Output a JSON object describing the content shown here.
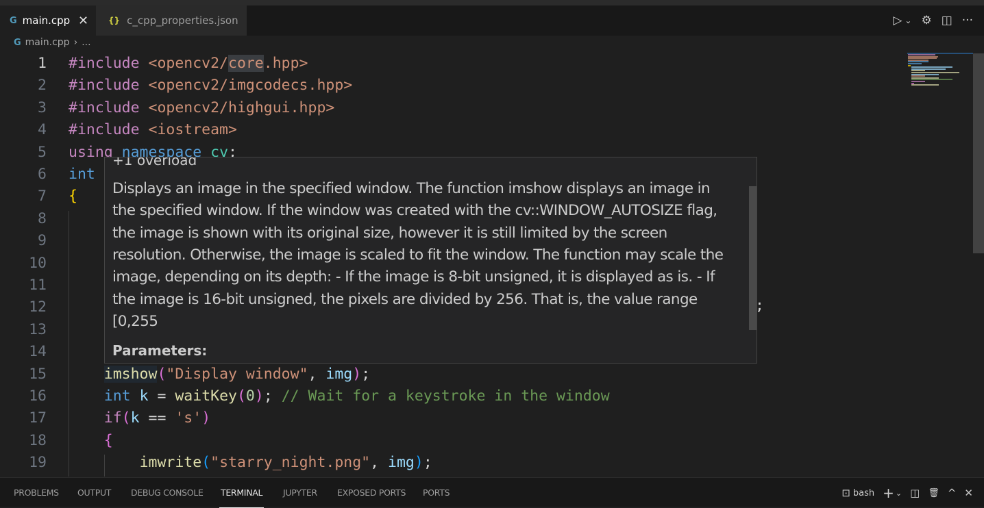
{
  "tabs": [
    {
      "label": "main.cpp",
      "icon": "cpp-icon",
      "active": true
    },
    {
      "label": "c_cpp_properties.json",
      "icon": "json-braces-icon",
      "active": false
    }
  ],
  "tab_icons": {
    "cpp": "G",
    "json": "{}",
    "close": "✕"
  },
  "toolbar": {
    "run": "▷",
    "run_dropdown": "⌄",
    "settings": "⚙",
    "split": "◫",
    "more": "···"
  },
  "breadcrumb": {
    "file": "main.cpp",
    "sep": "›",
    "rest": "..."
  },
  "editor": {
    "lines": [
      {
        "n": "1",
        "t": [
          [
            "#include ",
            "kw"
          ],
          [
            "<opencv2/",
            "str"
          ],
          [
            "core",
            "str hl"
          ],
          [
            ".hpp>",
            "str"
          ]
        ]
      },
      {
        "n": "2",
        "t": [
          [
            "#include ",
            "kw"
          ],
          [
            "<opencv2/imgcodecs.hpp>",
            "str"
          ]
        ]
      },
      {
        "n": "3",
        "t": [
          [
            "#include ",
            "kw"
          ],
          [
            "<opencv2/highgui.hpp>",
            "str"
          ]
        ]
      },
      {
        "n": "4",
        "t": [
          [
            "#include ",
            "kw"
          ],
          [
            "<iostream>",
            "str"
          ]
        ]
      },
      {
        "n": "5",
        "t": [
          [
            "using ",
            "kw"
          ],
          [
            "namespace ",
            "ty"
          ],
          [
            "cv",
            "ns"
          ],
          [
            ";",
            "pl"
          ]
        ]
      },
      {
        "n": "6",
        "t": [
          [
            "int",
            "ty"
          ]
        ]
      },
      {
        "n": "7",
        "t": [
          [
            "{",
            "b1"
          ]
        ]
      },
      {
        "n": "8",
        "t": []
      },
      {
        "n": "9",
        "t": []
      },
      {
        "n": "10",
        "t": []
      },
      {
        "n": "11",
        "t": []
      },
      {
        "n": "12",
        "t": []
      },
      {
        "n": "13",
        "t": []
      },
      {
        "n": "14",
        "t": []
      },
      {
        "n": "15",
        "t": [
          [
            "    ",
            "pl"
          ],
          [
            "imshow",
            "fn hl2"
          ],
          [
            "(",
            "b2"
          ],
          [
            "\"Display window\"",
            "str"
          ],
          [
            ", ",
            "pl"
          ],
          [
            "img",
            "var"
          ],
          [
            ")",
            "b2"
          ],
          [
            ";",
            "pl"
          ]
        ]
      },
      {
        "n": "16",
        "t": [
          [
            "    ",
            "pl"
          ],
          [
            "int ",
            "ty"
          ],
          [
            "k",
            "var"
          ],
          [
            " = ",
            "pl"
          ],
          [
            "waitKey",
            "fn"
          ],
          [
            "(",
            "b2"
          ],
          [
            "0",
            "num"
          ],
          [
            ")",
            "b2"
          ],
          [
            "; ",
            "pl"
          ],
          [
            "// Wait for a keystroke in the window",
            "cm"
          ]
        ]
      },
      {
        "n": "17",
        "t": [
          [
            "    ",
            "pl"
          ],
          [
            "if",
            "kw"
          ],
          [
            "(",
            "b2"
          ],
          [
            "k",
            "var"
          ],
          [
            " == ",
            "pl"
          ],
          [
            "'s'",
            "str"
          ],
          [
            ")",
            "b2"
          ]
        ]
      },
      {
        "n": "18",
        "t": [
          [
            "    ",
            "pl"
          ],
          [
            "{",
            "b2"
          ]
        ]
      },
      {
        "n": "19",
        "t": [
          [
            "        ",
            "pl"
          ],
          [
            "imwrite",
            "fn"
          ],
          [
            "(",
            "b3"
          ],
          [
            "\"starry_night.png\"",
            "str"
          ],
          [
            ", ",
            "pl"
          ],
          [
            "img",
            "var"
          ],
          [
            ")",
            "b3"
          ],
          [
            ";",
            "pl"
          ]
        ]
      }
    ],
    "line12_tail": ";"
  },
  "hover": {
    "overloads": "+1 overload",
    "lines": [
      "Displays an image in the specified window. The function imshow displays an image in",
      "the specified window. If the window was created with the cv::WINDOW_AUTOSIZE flag,",
      "the image is shown with its original size, however it is still limited by the screen",
      "resolution. Otherwise, the image is scaled to fit the window. The function may scale the",
      "image, depending on its depth: - If the image is 8-bit unsigned, it is displayed as is. - If",
      "the image is 16-bit unsigned, the pixels are divided by 256. That is, the value range",
      "[0,255"
    ],
    "parameters_label": "Parameters:"
  },
  "panel": {
    "tabs": [
      "PROBLEMS",
      "OUTPUT",
      "DEBUG CONSOLE",
      "TERMINAL",
      "JUPYTER",
      "EXPOSED PORTS",
      "PORTS"
    ],
    "active": "TERMINAL",
    "terminal_name": "bash",
    "icons": {
      "terminal": "⊡",
      "add": "+",
      "dropdown": "⌄",
      "split": "◫",
      "trash": "🗑",
      "maximize": "^",
      "close": "✕"
    }
  }
}
